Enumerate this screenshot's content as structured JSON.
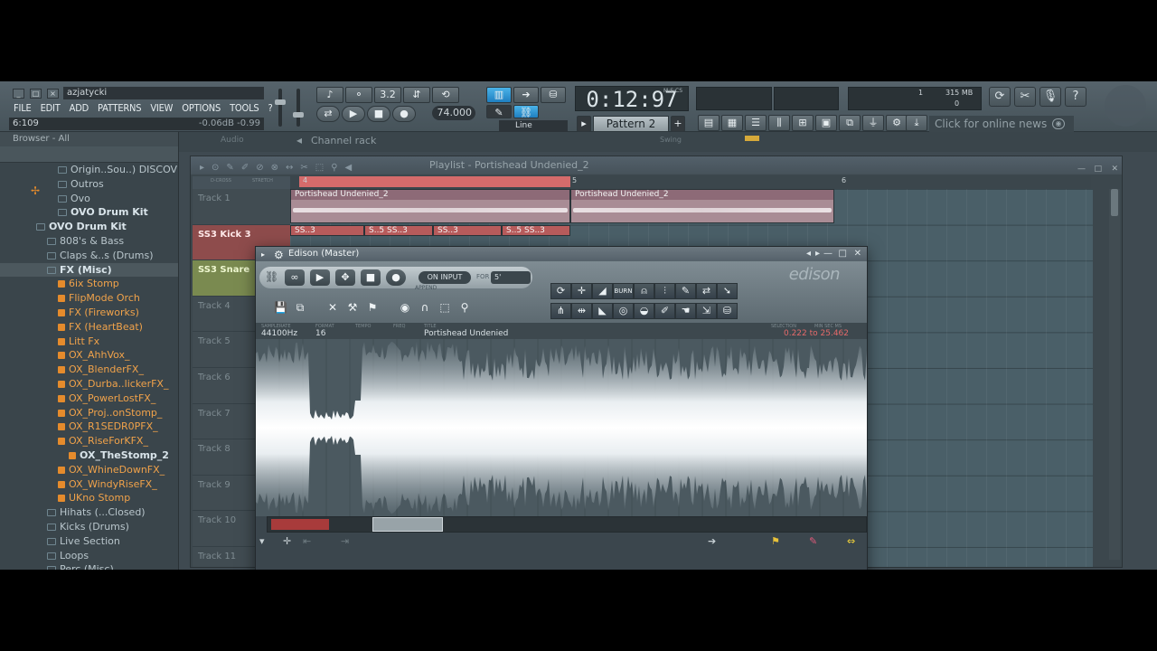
{
  "app": {
    "user": "azjatycki",
    "menu": [
      "FILE",
      "EDIT",
      "ADD",
      "PATTERNS",
      "VIEW",
      "OPTIONS",
      "TOOLS",
      "?"
    ],
    "hint_left": "6:109",
    "hint_right": "-0.06dB  -0.99",
    "question_label": "?"
  },
  "toolbar": {
    "tempo": "74.000",
    "time": "0:12:97",
    "time_unit": "M:S:CS",
    "time_signature": "3.2",
    "pattern": "Pattern 2",
    "line_mode": "Line",
    "mem_value": "315 MB",
    "cpu_value": "1",
    "poly_value": "0",
    "news": "Click for online news"
  },
  "browser": {
    "title": "Browser - All",
    "items": [
      {
        "label": "Origin..Sou..) DISCOVER",
        "style": "folder"
      },
      {
        "label": "Outros",
        "style": "folder"
      },
      {
        "label": "Ovo",
        "style": "folder"
      },
      {
        "label": "OVO Drum Kit",
        "style": "folder-open"
      },
      {
        "label": "OVO Drum Kit",
        "style": "folder-open"
      },
      {
        "label": "808's & Bass",
        "style": "folder"
      },
      {
        "label": "Claps &..s (Drums)",
        "style": "folder"
      },
      {
        "label": "FX (Misc)",
        "style": "selected"
      },
      {
        "label": "6ix Stomp",
        "style": "file"
      },
      {
        "label": "FlipMode Orch",
        "style": "file"
      },
      {
        "label": "FX (Fireworks)",
        "style": "file"
      },
      {
        "label": "FX (HeartBeat)",
        "style": "file"
      },
      {
        "label": "Litt Fx",
        "style": "file"
      },
      {
        "label": "OX_AhhVox_",
        "style": "file"
      },
      {
        "label": "OX_BlenderFX_",
        "style": "file"
      },
      {
        "label": "OX_Durba..lickerFX_",
        "style": "file"
      },
      {
        "label": "OX_PowerLostFX_",
        "style": "file"
      },
      {
        "label": "OX_Proj..onStomp_",
        "style": "file"
      },
      {
        "label": "OX_R1SEDR0PFX_",
        "style": "file"
      },
      {
        "label": "OX_RiseForKFX_",
        "style": "file"
      },
      {
        "label": "OX_TheStomp_2",
        "style": "file-bold"
      },
      {
        "label": "OX_WhineDownFX_",
        "style": "file"
      },
      {
        "label": "OX_WindyRiseFX_",
        "style": "file"
      },
      {
        "label": "UKno Stomp",
        "style": "file"
      },
      {
        "label": "Hihats (...Closed)",
        "style": "folder"
      },
      {
        "label": "Kicks (Drums)",
        "style": "folder"
      },
      {
        "label": "Live Section",
        "style": "folder"
      },
      {
        "label": "Loops",
        "style": "folder"
      },
      {
        "label": "Perc (Misc)",
        "style": "folder"
      }
    ]
  },
  "channel_rack": {
    "audio_label": "Audio",
    "title": "Channel rack",
    "swing_label": "Swing"
  },
  "playlist": {
    "title": "Playlist - Portishead  Undenied_2",
    "ruler": [
      "4",
      "5",
      "6"
    ],
    "tracks": [
      {
        "label": "Track 1",
        "style": "normal"
      },
      {
        "label": "SS3 Kick 3",
        "style": "kick"
      },
      {
        "label": "SS3 Snare",
        "style": "snare"
      },
      {
        "label": "Track 4",
        "style": "normal"
      },
      {
        "label": "Track 5",
        "style": "normal"
      },
      {
        "label": "Track 6",
        "style": "normal"
      },
      {
        "label": "Track 7",
        "style": "normal"
      },
      {
        "label": "Track 8",
        "style": "normal"
      },
      {
        "label": "Track 9",
        "style": "normal"
      },
      {
        "label": "Track 10",
        "style": "normal"
      },
      {
        "label": "Track 11",
        "style": "normal"
      }
    ],
    "clips": [
      {
        "name": "Portishead  Undenied_2"
      },
      {
        "name": "Portishead  Undenied_2"
      }
    ],
    "pattern_clips": [
      "SS..3",
      "S..5 SS..3",
      "SS..3",
      "S..5 SS..3"
    ],
    "toolbar_labels": {
      "dcross": "D-CROSS",
      "stretch": "STRETCH"
    }
  },
  "edison": {
    "title": "Edison (Master)",
    "logo": "edison",
    "on_input": "ON INPUT",
    "for_label": "FOR",
    "for_value": "5'",
    "append_label": "APPEND",
    "info_labels": [
      "SAMPLERATE",
      "FORMAT",
      "TEMPO",
      "FREQ",
      "TITLE",
      "SELECTION",
      "MIN SEC MS"
    ],
    "samplerate": "44100Hz",
    "format": "16",
    "title_value": "Portishead  Undenied",
    "selection": "0.222 to 25.462",
    "burn_label": "BURN"
  }
}
